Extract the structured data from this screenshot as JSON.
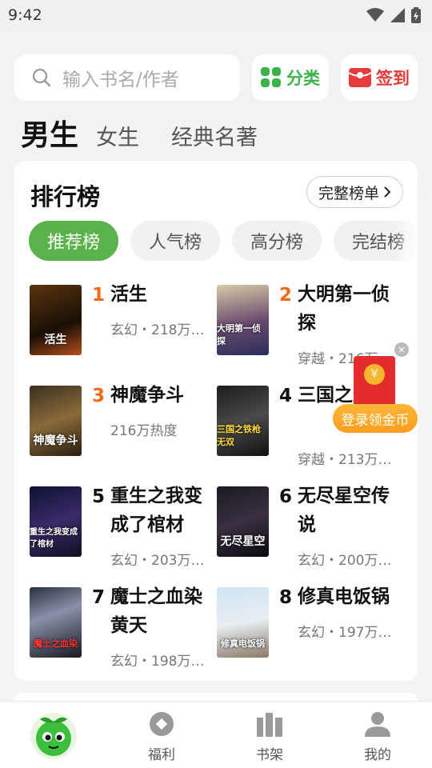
{
  "status_bar": {
    "time": "9:42"
  },
  "search": {
    "placeholder": "输入书名/作者"
  },
  "top_buttons": {
    "category_label": "分类",
    "signin_label": "签到"
  },
  "gender_tabs": [
    {
      "label": "男生",
      "active": true
    },
    {
      "label": "女生",
      "active": false
    },
    {
      "label": "经典名著",
      "active": false
    }
  ],
  "ranking": {
    "title": "排行榜",
    "full_list_label": "完整榜单",
    "chips": [
      "推荐榜",
      "人气榜",
      "高分榜",
      "完结榜"
    ],
    "books": [
      {
        "rank": "1",
        "name": "活生",
        "meta": "玄幻・218万…",
        "cover_text": "活生"
      },
      {
        "rank": "2",
        "name": "大明第一侦探",
        "meta": "穿越・216万…",
        "cover_text": "大明第一侦探"
      },
      {
        "rank": "3",
        "name": "神魔争斗",
        "meta": "216万热度",
        "cover_text": "神魔争斗"
      },
      {
        "rank": "4",
        "name": "三国之无双",
        "meta": "穿越・213万…",
        "cover_text": "三国之铁枪无双"
      },
      {
        "rank": "5",
        "name": "重生之我变成了棺材",
        "meta": "玄幻・203万…",
        "cover_text": "重生之我变成了棺材"
      },
      {
        "rank": "6",
        "name": "无尽星空传说",
        "meta": "玄幻・200万…",
        "cover_text": "无尽星空"
      },
      {
        "rank": "7",
        "name": "魔士之血染黄天",
        "meta": "玄幻・198万…",
        "cover_text": "魔士之血染"
      },
      {
        "rank": "8",
        "name": "修真电饭锅",
        "meta": "玄幻・197万…",
        "cover_text": "修真电饭锅"
      }
    ]
  },
  "promo": {
    "gold_label": "登录领金币",
    "seal_text": "¥",
    "close_text": "×"
  },
  "bottom_nav": {
    "welfare": "福利",
    "bookshelf": "书架",
    "mine": "我的"
  },
  "colors": {
    "accent_green": "#5ab24a",
    "rank_orange": "#f26a1b",
    "signin_red": "#e73b3b"
  }
}
